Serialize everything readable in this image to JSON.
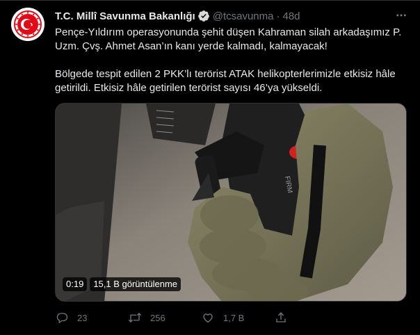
{
  "tweet": {
    "author_name": "T.C. Millî Savunma Bakanlığı",
    "handle": "@tcsavunma",
    "separator": "·",
    "time": "48d",
    "paragraph1": "Pençe-Yıldırım operasyonunda şehit düşen Kahraman silah arkadaşımız P. Uzm. Çvş. Ahmet Asan’ın kanı yerde kalmadı, kalmayacak!",
    "paragraph2": "Bölgede tespit edilen 2 PKK’lı terörist ATAK helikopterlerimizle etkisiz hâle getirildi. Etkisiz hâle getirilen terörist sayısı 46’ya yükseldi."
  },
  "video": {
    "duration": "0:19",
    "views": "15,1 B görüntülenme",
    "stick_label": "FIRM"
  },
  "actions": {
    "reply_count": "23",
    "retweet_count": "256",
    "like_count": "1,7 B"
  },
  "icons": {
    "verified": "verified-badge-icon",
    "more": "more-icon",
    "reply": "reply-icon",
    "retweet": "retweet-icon",
    "like": "heart-icon",
    "share": "share-icon"
  },
  "colors": {
    "background": "#000000",
    "text": "#e7e9ea",
    "muted": "#71767b",
    "logo_red": "#e30a17"
  }
}
